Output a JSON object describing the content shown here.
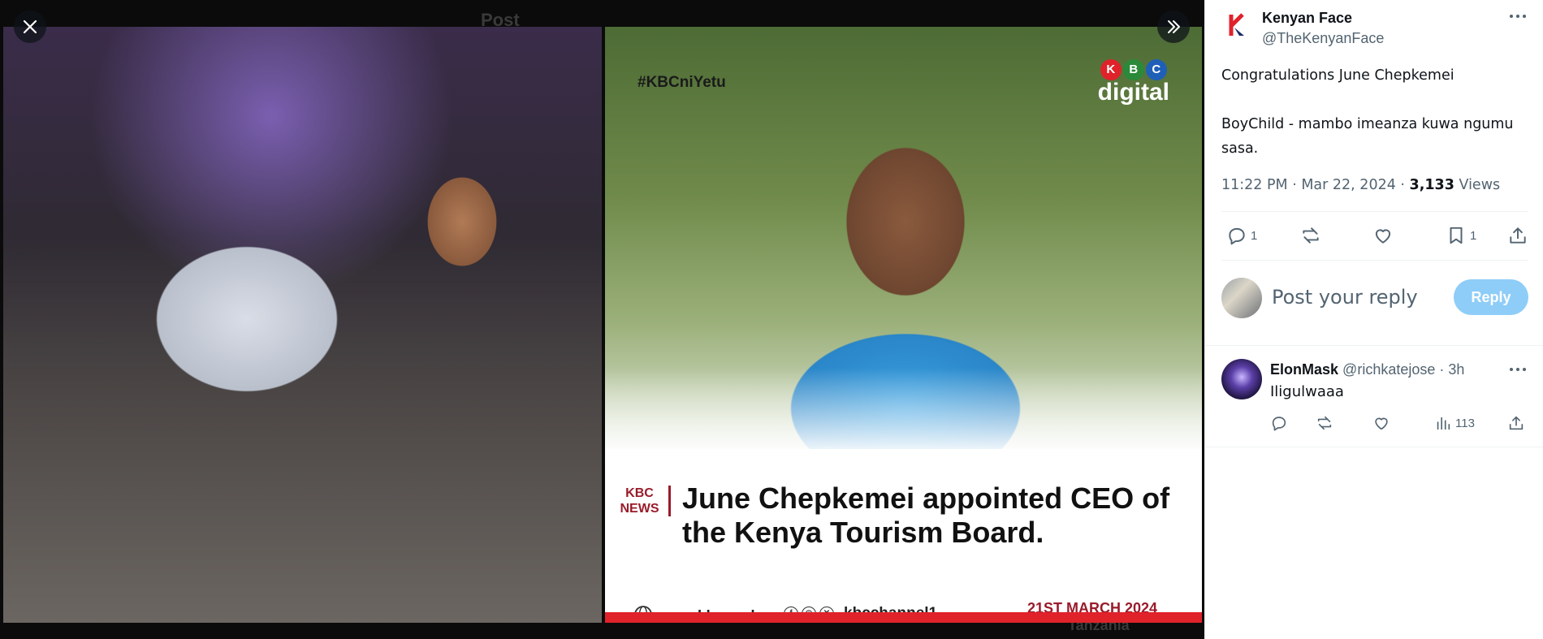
{
  "viewer": {
    "background_title": "Post",
    "background_caption": "Tanzania",
    "left_image_alt": "Woman in polka-dot dress posing at a bar",
    "right_card": {
      "hashtag": "#KBCniYetu",
      "brand_letters": [
        "K",
        "B",
        "C"
      ],
      "brand_word": "digital",
      "news_label": "KBC NEWS",
      "headline": "June Chepkemei appointed CEO of the Kenya Tourism Board.",
      "website": "www.kbc.co.ke",
      "social_handle": "kbcchannel1",
      "date": "21ST MARCH 2024"
    }
  },
  "tweet": {
    "author_name": "Kenyan Face",
    "author_handle": "@TheKenyanFace",
    "text": "Congratulations June Chepkemei\n\nBoyChild - mambo imeanza kuwa ngumu sasa.",
    "time": "11:22 PM · Mar 22, 2024 · ",
    "views_count": "3,133",
    "views_label": "Views",
    "reply_count": "1",
    "bookmark_count": "1"
  },
  "composer": {
    "placeholder": "Post your reply",
    "reply_button": "Reply"
  },
  "reply": {
    "name": "ElonMask",
    "handle": "@richkatejose",
    "time": "· 3h",
    "text": "Iligulwaaa",
    "views": "113"
  },
  "colors": {
    "accent": "#1d9bf0",
    "reply_button_disabled": "#8ecdf8",
    "muted_text": "#536471",
    "kbc_red": "#e0222a"
  }
}
